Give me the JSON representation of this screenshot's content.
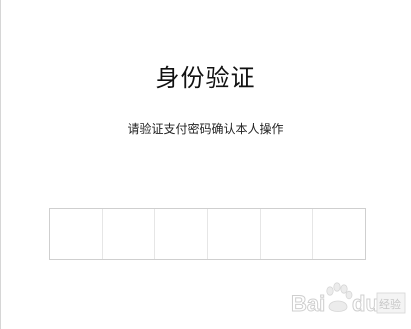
{
  "header": {
    "title": "身份验证",
    "subtitle": "请验证支付密码确认本人操作"
  },
  "pin_input": {
    "length": 6,
    "filled": 0
  },
  "watermark": {
    "text": "Baidu经验"
  }
}
